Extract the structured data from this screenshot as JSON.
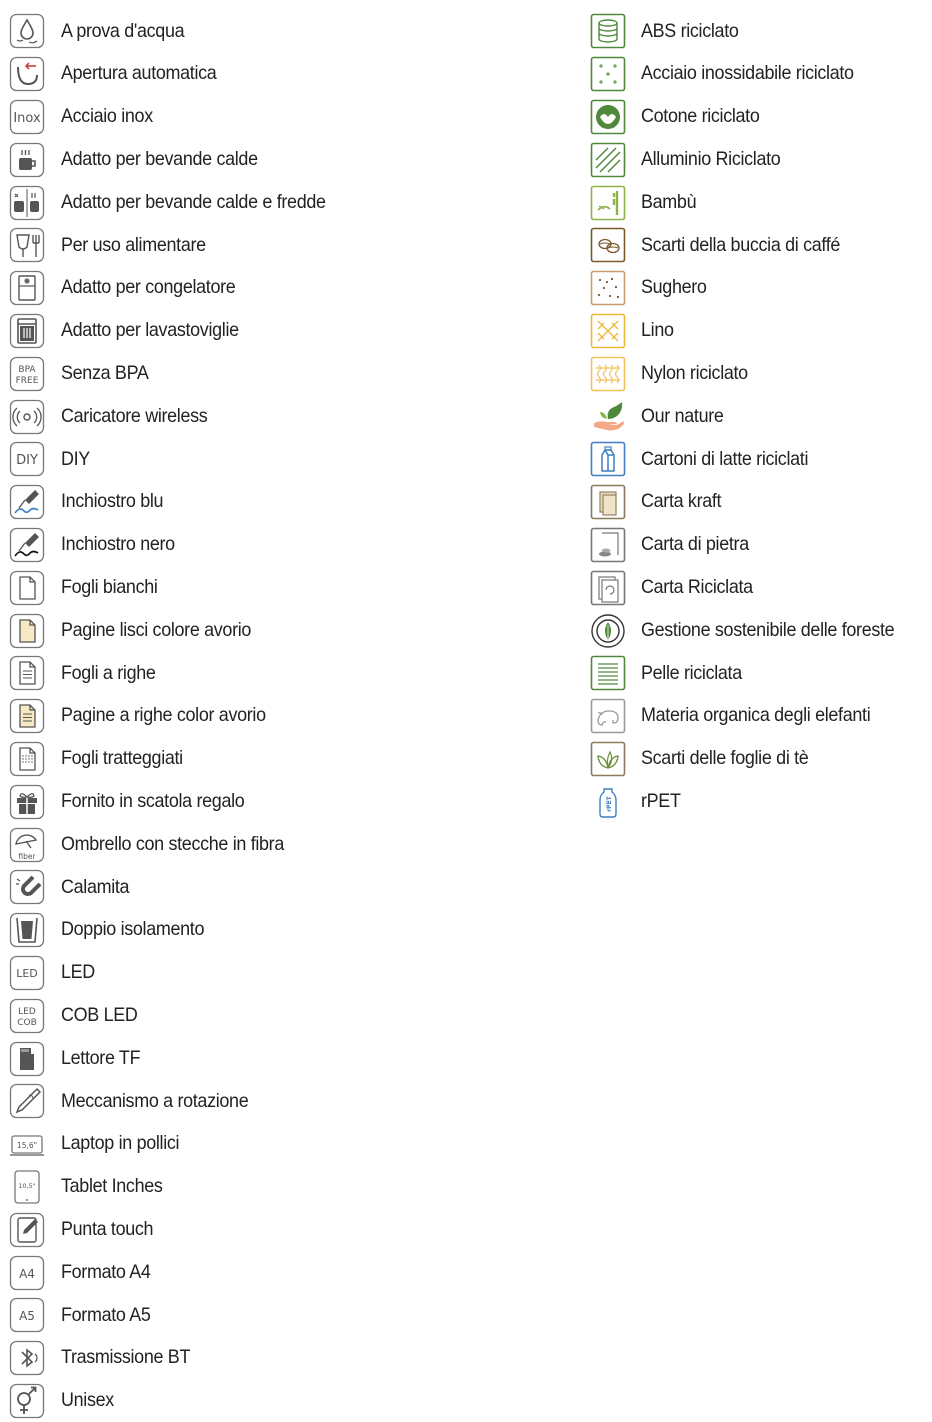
{
  "left_items": [
    {
      "icon": "water-drop-icon",
      "label": "A prova d'acqua"
    },
    {
      "icon": "auto-open-icon",
      "label": "Apertura automatica"
    },
    {
      "icon": "inox-icon",
      "icon_text": "Inox",
      "label": "Acciaio inox"
    },
    {
      "icon": "hot-cup-icon",
      "label": "Adatto per bevande calde"
    },
    {
      "icon": "hot-cold-cup-icon",
      "label": "Adatto per bevande calde e fredde"
    },
    {
      "icon": "food-safe-icon",
      "label": "Per uso alimentare"
    },
    {
      "icon": "freezer-icon",
      "label": "Adatto per congelatore"
    },
    {
      "icon": "dishwasher-icon",
      "label": "Adatto per lavastoviglie"
    },
    {
      "icon": "bpa-free-icon",
      "icon_text": "BPA FREE",
      "label": "Senza BPA"
    },
    {
      "icon": "wireless-charger-icon",
      "label": "Caricatore wireless"
    },
    {
      "icon": "diy-icon",
      "icon_text": "DIY",
      "label": "DIY"
    },
    {
      "icon": "blue-ink-icon",
      "label": "Inchiostro blu"
    },
    {
      "icon": "black-ink-icon",
      "label": "Inchiostro nero"
    },
    {
      "icon": "blank-sheet-icon",
      "label": "Fogli bianchi"
    },
    {
      "icon": "ivory-sheet-icon",
      "label": "Pagine lisci colore avorio"
    },
    {
      "icon": "lined-sheet-icon",
      "label": "Fogli a righe"
    },
    {
      "icon": "ivory-lined-sheet-icon",
      "label": "Pagine a righe color avorio"
    },
    {
      "icon": "dotted-sheet-icon",
      "label": "Fogli tratteggiati"
    },
    {
      "icon": "gift-box-icon",
      "label": "Fornito in scatola regalo"
    },
    {
      "icon": "fiber-umbrella-icon",
      "icon_text": "fiber",
      "label": "Ombrello con stecche in fibra"
    },
    {
      "icon": "magnet-icon",
      "label": "Calamita"
    },
    {
      "icon": "double-insulation-icon",
      "label": "Doppio isolamento"
    },
    {
      "icon": "led-icon",
      "icon_text": "LED",
      "label": "LED"
    },
    {
      "icon": "cob-led-icon",
      "icon_text": "LED COB",
      "label": "COB LED"
    },
    {
      "icon": "tf-card-icon",
      "label": "Lettore TF"
    },
    {
      "icon": "twist-pen-icon",
      "label": "Meccanismo a rotazione"
    },
    {
      "icon": "laptop-icon",
      "icon_text": "15,6\"",
      "label": "Laptop in pollici"
    },
    {
      "icon": "tablet-icon",
      "icon_text": "10,5\"",
      "label": "Tablet Inches"
    },
    {
      "icon": "touch-pen-icon",
      "label": "Punta touch"
    },
    {
      "icon": "a4-icon",
      "icon_text": "A4",
      "label": "Formato A4"
    },
    {
      "icon": "a5-icon",
      "icon_text": "A5",
      "label": "Formato A5"
    },
    {
      "icon": "bluetooth-icon",
      "label": "Trasmissione BT"
    },
    {
      "icon": "unisex-icon",
      "label": "Unisex"
    }
  ],
  "right_items": [
    {
      "icon": "recycled-abs-icon",
      "label": "ABS riciclato"
    },
    {
      "icon": "recycled-steel-icon",
      "label": "Acciaio inossidabile riciclato"
    },
    {
      "icon": "recycled-cotton-icon",
      "label": "Cotone riciclato"
    },
    {
      "icon": "recycled-aluminium-icon",
      "label": "Alluminio Riciclato"
    },
    {
      "icon": "bamboo-icon",
      "label": "Bambù"
    },
    {
      "icon": "coffee-husk-icon",
      "label": "Scarti della buccia di caffé"
    },
    {
      "icon": "cork-icon",
      "label": "Sughero"
    },
    {
      "icon": "linen-icon",
      "label": "Lino"
    },
    {
      "icon": "recycled-nylon-icon",
      "label": "Nylon riciclato"
    },
    {
      "icon": "our-nature-icon",
      "label": "Our nature"
    },
    {
      "icon": "milk-carton-icon",
      "label": "Cartoni di latte riciclati"
    },
    {
      "icon": "kraft-paper-icon",
      "label": "Carta kraft"
    },
    {
      "icon": "stone-paper-icon",
      "label": "Carta di pietra"
    },
    {
      "icon": "recycled-paper-icon",
      "label": "Carta Riciclata"
    },
    {
      "icon": "fsc-icon",
      "label": "Gestione sostenibile delle foreste"
    },
    {
      "icon": "recycled-leather-icon",
      "label": "Pelle riciclata"
    },
    {
      "icon": "elephant-dung-icon",
      "label": "Materia organica degli elefanti"
    },
    {
      "icon": "tea-leaves-icon",
      "label": "Scarti delle foglie di tè"
    },
    {
      "icon": "rpet-icon",
      "icon_text": "rPET",
      "label": "rPET"
    }
  ],
  "colors": {
    "text": "#222222",
    "icon_stroke": "#555555",
    "green": "#4f8a3c",
    "blue": "#3f7fc1",
    "brown": "#7a5a2b",
    "cork": "#c89c73",
    "linen": "#f0b83a",
    "nylon": "#f2c15a",
    "ivory": "#f7e9c4",
    "skin": "#f3a886"
  }
}
